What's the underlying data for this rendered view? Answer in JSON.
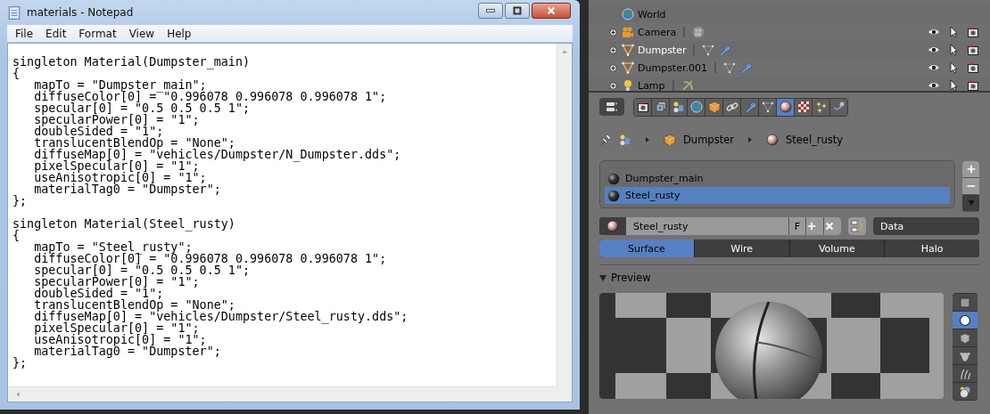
{
  "notepad": {
    "title": "materials - Notepad",
    "menu": [
      "File",
      "Edit",
      "Format",
      "View",
      "Help"
    ],
    "blocks": [
      [
        "singleton Material(Dumpster_main)",
        "{",
        "   mapTo = \"Dumpster_main\";",
        "   diffuseColor[0] = \"0.996078 0.996078 0.996078 1\";",
        "   specular[0] = \"0.5 0.5 0.5 1\";",
        "   specularPower[0] = \"1\";",
        "   doubleSided = \"1\";",
        "   translucentBlendOp = \"None\";",
        "   diffuseMap[0] = \"vehicles/Dumpster/N_Dumpster.dds\";",
        "   pixelSpecular[0] = \"1\";",
        "   useAnisotropic[0] = \"1\";",
        "   materialTag0 = \"Dumpster\";",
        "};"
      ],
      [
        "singleton Material(Steel_rusty)",
        "{",
        "   mapTo = \"Steel_rusty\";",
        "   diffuseColor[0] = \"0.996078 0.996078 0.996078 1\";",
        "   specular[0] = \"0.5 0.5 0.5 1\";",
        "   specularPower[0] = \"1\";",
        "   doubleSided = \"1\";",
        "   translucentBlendOp = \"None\";",
        "   diffuseMap[0] = \"vehicles/Dumpster/Steel_rusty.dds\";",
        "   pixelSpecular[0] = \"1\";",
        "   useAnisotropic[0] = \"1\";",
        "   materialTag0 = \"Dumpster\";",
        "};"
      ]
    ]
  },
  "outliner": {
    "rows": [
      {
        "label": "World",
        "kind": "world",
        "expandable": false,
        "selected": false
      },
      {
        "label": "Camera",
        "kind": "camera",
        "expandable": true,
        "selected": false
      },
      {
        "label": "Dumpster",
        "kind": "mesh",
        "expandable": true,
        "selected": true
      },
      {
        "label": "Dumpster.001",
        "kind": "mesh",
        "expandable": true,
        "selected": false
      },
      {
        "label": "Lamp",
        "kind": "lamp",
        "expandable": true,
        "selected": false
      }
    ]
  },
  "properties": {
    "tabs": [
      {
        "kind": "render",
        "selected": false
      },
      {
        "kind": "layers",
        "selected": false
      },
      {
        "kind": "scene",
        "selected": false
      },
      {
        "kind": "world",
        "selected": false
      },
      {
        "kind": "object",
        "selected": false
      },
      {
        "kind": "constraints",
        "selected": false
      },
      {
        "kind": "modifiers",
        "selected": false
      },
      {
        "kind": "data",
        "selected": false
      },
      {
        "kind": "material",
        "selected": true
      },
      {
        "kind": "texture",
        "selected": false
      },
      {
        "kind": "particles",
        "selected": false
      },
      {
        "kind": "physics",
        "selected": false
      }
    ],
    "breadcrumb": [
      {
        "label": "Dumpster",
        "kind": "object"
      },
      {
        "label": "Steel_rusty",
        "kind": "material"
      }
    ],
    "slots": [
      {
        "name": "Dumpster_main",
        "selected": false
      },
      {
        "name": "Steel_rusty",
        "selected": true
      }
    ],
    "material": {
      "name": "Steel_rusty",
      "fake_user": "F",
      "link": "Data"
    },
    "type_tabs": [
      {
        "label": "Surface",
        "selected": true
      },
      {
        "label": "Wire",
        "selected": false
      },
      {
        "label": "Volume",
        "selected": false
      },
      {
        "label": "Halo",
        "selected": false
      }
    ],
    "preview": {
      "title": "Preview",
      "expanded": true,
      "shapes": [
        {
          "kind": "plane",
          "selected": false
        },
        {
          "kind": "sphere",
          "selected": true
        },
        {
          "kind": "cube",
          "selected": false
        },
        {
          "kind": "monkey",
          "selected": false
        },
        {
          "kind": "hair",
          "selected": false
        },
        {
          "kind": "sphere_sky",
          "selected": false
        }
      ]
    }
  }
}
